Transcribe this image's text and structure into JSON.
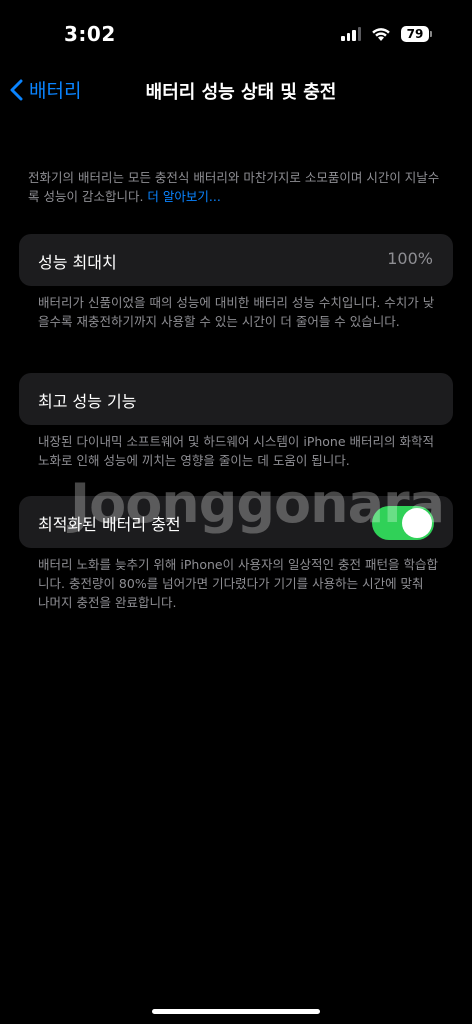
{
  "status_bar": {
    "time": "3:02",
    "battery_level": "79"
  },
  "nav": {
    "back_label": "배터리",
    "title": "배터리 성능 상태 및 충전"
  },
  "intro": {
    "text": "전화기의 배터리는 모든 충전식 배터리와 마찬가지로 소모품이며 시간이 지날수록 성능이 감소합니다.",
    "link": "더 알아보기..."
  },
  "max_capacity": {
    "label": "성능 최대치",
    "value": "100%",
    "note": "배터리가 신품이었을 때의 성능에 대비한 배터리 성능 수치입니다. 수치가 낮을수록 재충전하기까지 사용할 수 있는 시간이 더 줄어들 수 있습니다."
  },
  "peak_performance": {
    "label": "최고 성능 기능",
    "note": "내장된 다이내믹 소프트웨어 및 하드웨어 시스템이 iPhone 배터리의 화학적 노화로 인해 성능에 끼치는 영향을 줄이는 데 도움이 됩니다."
  },
  "optimized_charging": {
    "label": "최적화된 배터리 충전",
    "enabled": true,
    "note": "배터리 노화를 늦추기 위해 iPhone이 사용자의 일상적인 충전 패턴을 학습합니다. 충전량이 80%를 넘어가면 기다렸다가 기기를 사용하는 시간에 맞춰 나머지 충전을 완료합니다."
  },
  "watermark": "Joonggonara",
  "colors": {
    "accent": "#0a84ff",
    "toggle_on": "#30d158",
    "card_bg": "#1c1c1e",
    "secondary_text": "#8e8e93"
  }
}
